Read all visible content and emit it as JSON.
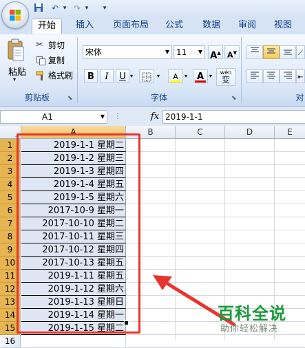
{
  "quick_access": {
    "undo_glyph": "↶",
    "redo_glyph": "↷",
    "more_glyph": "▾"
  },
  "tabs": [
    "开始",
    "插入",
    "页面布局",
    "公式",
    "数据",
    "审阅",
    "视图"
  ],
  "active_tab": "开始",
  "clipboard": {
    "paste_label": "粘贴",
    "cut_label": "剪切",
    "copy_label": "复制",
    "format_painter_label": "格式刷",
    "group_label": "剪贴板"
  },
  "font": {
    "name": "宋体",
    "size": "11",
    "grow_label": "A",
    "shrink_label": "A",
    "bold_label": "B",
    "italic_label": "I",
    "underline_label": "U",
    "fill_label": "A",
    "font_color_label": "A",
    "phonetic_label": "wén",
    "phonetic_char": "变",
    "group_label": "字体"
  },
  "alignment": {
    "group_label": "对"
  },
  "formula_bar": {
    "name_box": "A1",
    "fx_label": "fx",
    "value": "2019-1-1"
  },
  "grid": {
    "select_all_glyph": "◢",
    "columns": [
      "A",
      "B",
      "C",
      "D",
      "E"
    ],
    "rows": [
      {
        "num": "1",
        "a": "2019-1-1  星期二"
      },
      {
        "num": "2",
        "a": "2019-1-2  星期三"
      },
      {
        "num": "3",
        "a": "2019-1-3  星期四"
      },
      {
        "num": "4",
        "a": "2019-1-4  星期五"
      },
      {
        "num": "5",
        "a": "2019-1-5  星期六"
      },
      {
        "num": "6",
        "a": "2017-10-9  星期一"
      },
      {
        "num": "7",
        "a": "2017-10-10  星期二"
      },
      {
        "num": "8",
        "a": "2017-10-11  星期三"
      },
      {
        "num": "9",
        "a": "2017-10-12  星期四"
      },
      {
        "num": "10",
        "a": "2017-10-13  星期五"
      },
      {
        "num": "11",
        "a": "2019-1-11  星期五"
      },
      {
        "num": "12",
        "a": "2019-1-12  星期六"
      },
      {
        "num": "13",
        "a": "2019-1-13  星期日"
      },
      {
        "num": "14",
        "a": "2019-1-14  星期一"
      },
      {
        "num": "15",
        "a": "2019-1-15  星期二"
      },
      {
        "num": "16",
        "a": ""
      }
    ]
  },
  "watermark": {
    "title": "百科全说",
    "subtitle": "助你轻松解决"
  },
  "colors": {
    "highlight_box": "#e8342f",
    "arrow": "#e8342f",
    "accent": "#15428b"
  }
}
